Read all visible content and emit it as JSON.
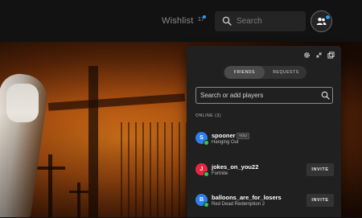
{
  "header": {
    "wishlist_label": "Wishlist",
    "wishlist_count": "17",
    "search_placeholder": "Search"
  },
  "friends_panel": {
    "tabs": [
      {
        "label": "FRIENDS",
        "active": true
      },
      {
        "label": "REQUESTS",
        "active": false
      }
    ],
    "search_placeholder": "Search or add players",
    "online_header": "ONLINE (3)",
    "friends": [
      {
        "initial": "S",
        "name": "spooner",
        "badge": "YOU",
        "status": "Hanging Out",
        "avatar_color": "#2d7ff0",
        "presence": "online"
      },
      {
        "initial": "J",
        "name": "jokes_on_you22",
        "status": "Fortnite",
        "invite_label": "INVITE",
        "avatar_color": "#e8273f",
        "presence": "online"
      },
      {
        "initial": "B",
        "name": "balloons_are_for_losers",
        "status": "Red Dead Redemption 2",
        "invite_label": "INVITE",
        "avatar_color": "#2d7ff0",
        "presence": "online"
      }
    ]
  },
  "colors": {
    "accent": "#2d9bf0",
    "online": "#34c759",
    "panel_bg": "#202020",
    "topbar_bg": "#121212"
  },
  "icons": {
    "search": "search-icon",
    "friends": "friends-icon",
    "settings": "gear-icon",
    "minimize": "collapse-icon",
    "popout": "popout-icon"
  }
}
